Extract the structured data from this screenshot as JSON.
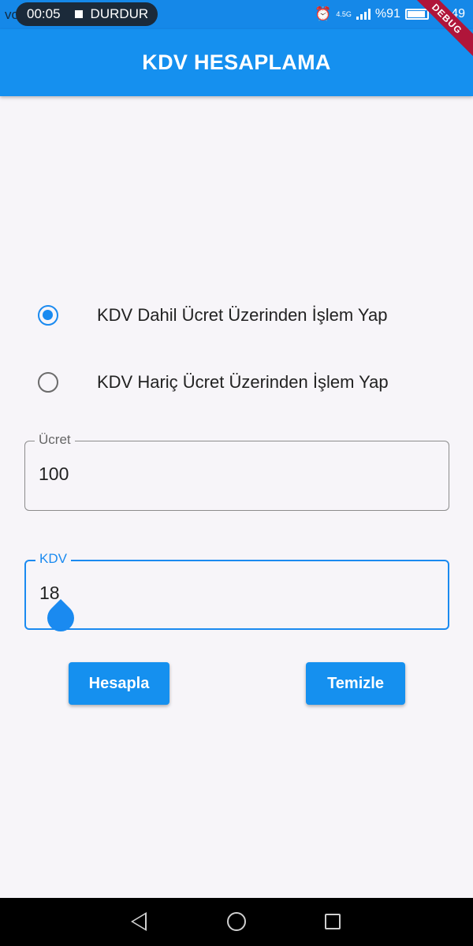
{
  "status_bar": {
    "background_text": "vo",
    "recording_time": "00:05",
    "stop_label": "DURDUR",
    "network": "4.5G",
    "battery_percent": "%91",
    "time": "01:49"
  },
  "debug_banner": "DEBUG",
  "app_bar": {
    "title": "KDV HESAPLAMA"
  },
  "radios": [
    {
      "label": "KDV Dahil Ücret Üzerinden İşlem Yap",
      "selected": true
    },
    {
      "label": "KDV Hariç Ücret Üzerinden İşlem Yap",
      "selected": false
    }
  ],
  "fields": {
    "price": {
      "label": "Ücret",
      "value": "100"
    },
    "vat": {
      "label": "KDV",
      "value": "18"
    }
  },
  "buttons": {
    "calculate": "Hesapla",
    "clear": "Temizle"
  },
  "colors": {
    "primary": "#1590ef",
    "accent": "#1a8af0",
    "background": "#f7f5f9"
  },
  "nav": {
    "back": "back-icon",
    "home": "home-icon",
    "recent": "recent-apps-icon"
  }
}
